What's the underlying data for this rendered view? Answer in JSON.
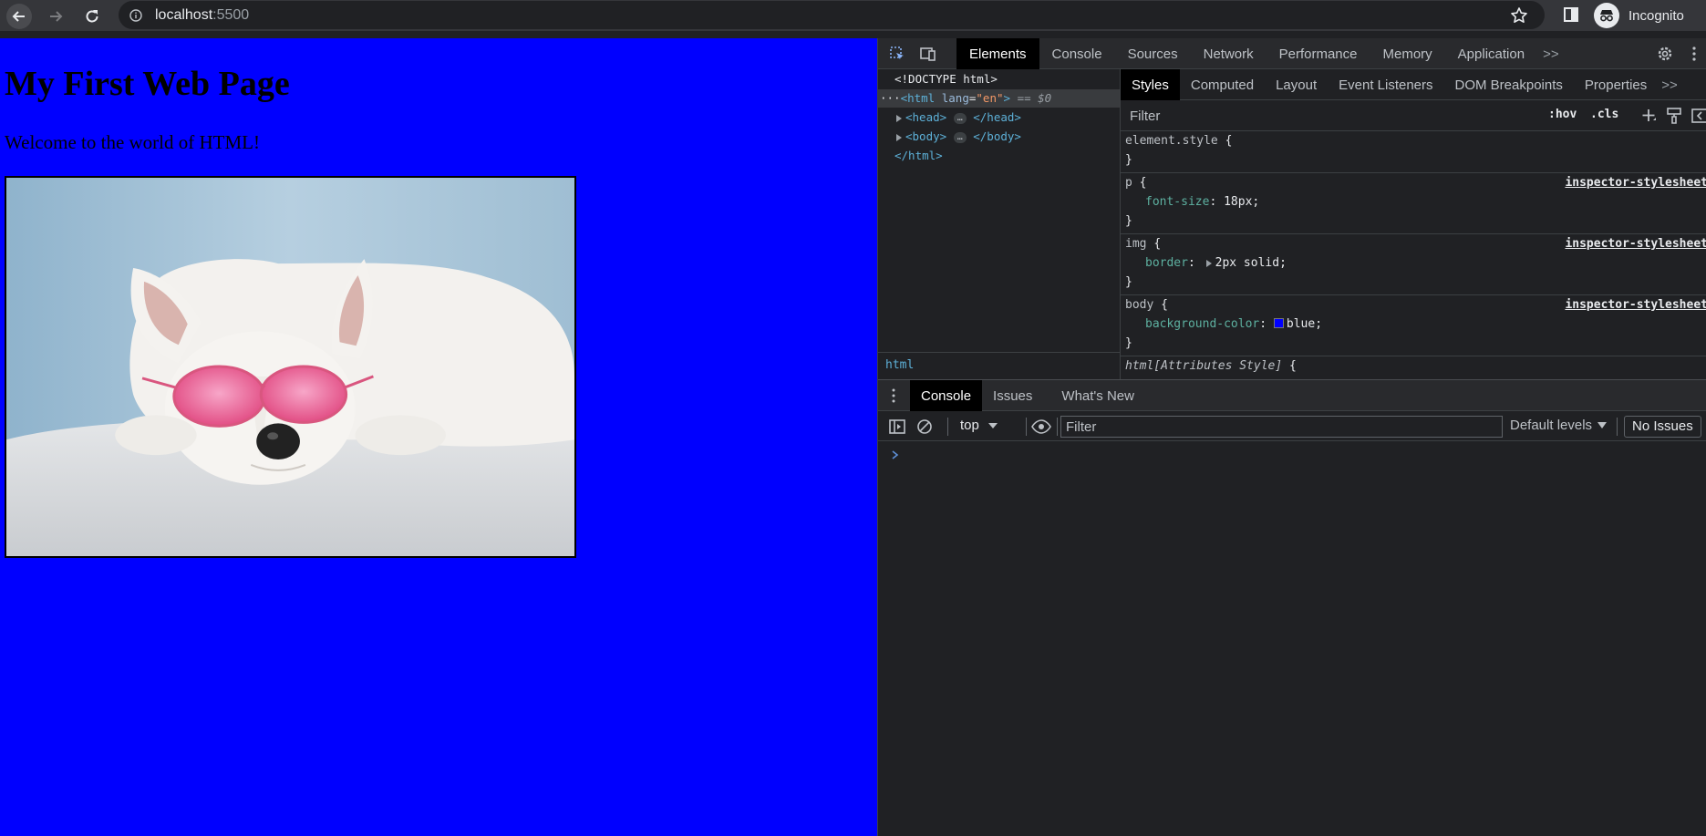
{
  "browser": {
    "url_host": "localhost",
    "url_port": ":5500",
    "profile_label": "Incognito"
  },
  "page": {
    "heading": "My First Web Page",
    "paragraph": "Welcome to the world of HTML!",
    "image_alt": "White dog lying on a blanket wearing pink heart-shaped sunglasses",
    "background_color": "#0000ff"
  },
  "devtools": {
    "tabs": [
      "Elements",
      "Console",
      "Sources",
      "Network",
      "Performance",
      "Memory",
      "Application"
    ],
    "more": ">>",
    "dom": {
      "doctype": "<!DOCTYPE html>",
      "html_open": "<html",
      "lang_attr": "lang",
      "lang_eq": "=",
      "lang_val": "\"en\"",
      "html_close_bracket": ">",
      "selected_marker": "== $0",
      "head_open": "<head>",
      "head_close": "</head>",
      "body_open": "<body>",
      "body_close": "</body>",
      "html_close": "</html>",
      "ellipsis": "…",
      "dots": "···"
    },
    "breadcrumb": "html",
    "styles_tabs": [
      "Styles",
      "Computed",
      "Layout",
      "Event Listeners",
      "DOM Breakpoints",
      "Properties"
    ],
    "styles_more": ">>",
    "styles_filter_placeholder": "Filter",
    "hov_label": ":hov",
    "cls_label": ".cls",
    "rules": {
      "element_style": {
        "selector": "element.style",
        "open": "{",
        "close": "}"
      },
      "p": {
        "selector": "p",
        "open": "{",
        "source": "inspector-stylesheet",
        "prop": "font-size",
        "colon": ":",
        "value": "18px;",
        "close": "}"
      },
      "img": {
        "selector": "img",
        "open": "{",
        "source": "inspector-stylesheet",
        "prop": "border",
        "colon": ":",
        "value": "2px solid;",
        "close": "}"
      },
      "body": {
        "selector": "body",
        "open": "{",
        "source": "inspector-stylesheet",
        "prop": "background-color",
        "colon": ":",
        "value": "blue;",
        "close": "}"
      },
      "html_attr": {
        "selector": "html[Attributes Style]",
        "open": "{"
      }
    },
    "drawer_tabs": [
      "Console",
      "Issues",
      "What's New"
    ],
    "console": {
      "context": "top",
      "filter_placeholder": "Filter",
      "levels": "Default levels",
      "issues": "No Issues"
    }
  }
}
